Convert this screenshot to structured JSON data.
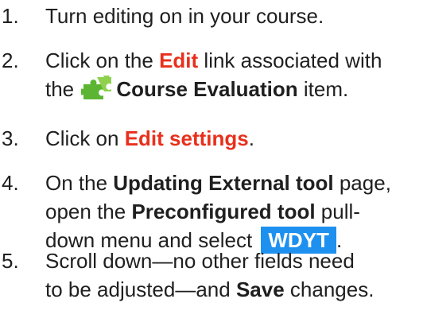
{
  "steps": [
    {
      "number": "1.",
      "line1": "Turn editing on in your course."
    },
    {
      "number": "2.",
      "line1_a": "Click on the ",
      "edit_link": "Edit",
      "line1_b": " link associated with",
      "line2_a": "the ",
      "item_name": "Course Evaluation",
      "line2_b": " item.",
      "icon": "puzzle-piece-icon"
    },
    {
      "number": "3.",
      "line1_a": "Click on ",
      "edit_settings": "Edit settings",
      "line1_b": "."
    },
    {
      "number": "4.",
      "line1_a": "On the ",
      "page_name": "Updating External tool",
      "line1_b": " page,",
      "line2_a": "open the ",
      "tool_name": "Preconfigured tool",
      "line2_b": " pull-",
      "line3_a": "down menu and select ",
      "selected_option": "WDYT",
      "line3_b": "."
    },
    {
      "number": "5.",
      "line1": "Scroll down—no other fields need",
      "line2_a": "to be adjusted—and ",
      "save_word": "Save",
      "line2_b": " changes."
    }
  ],
  "colors": {
    "red_link": "#e8301c",
    "wdyt_highlight": "#1e90f0",
    "puzzle_green": "#5cb532"
  }
}
